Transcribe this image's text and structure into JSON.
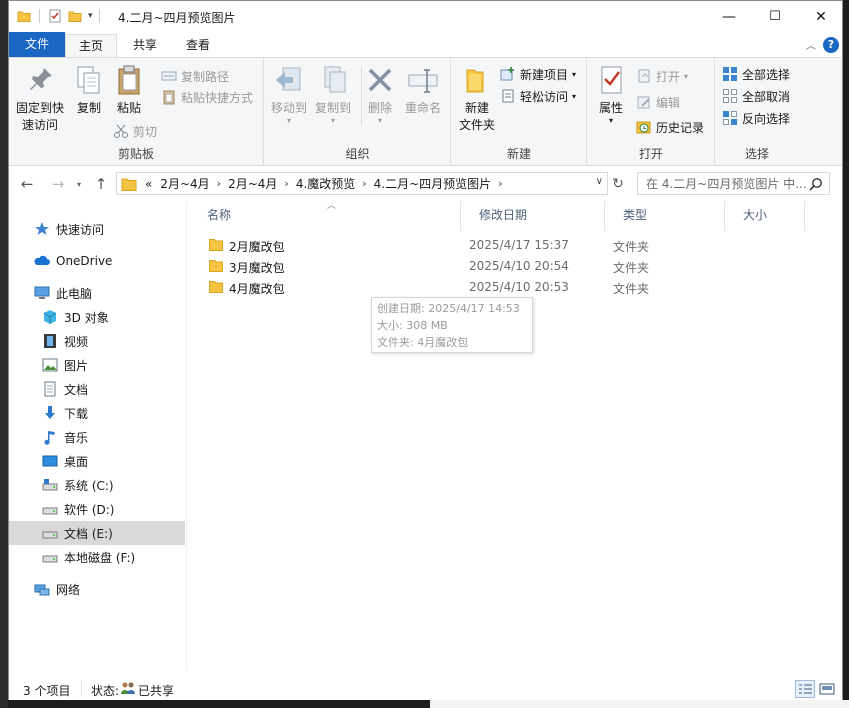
{
  "window": {
    "title": "4.二月~四月预览图片",
    "accent": "#1a66c3",
    "controls": {
      "minimize": "—",
      "maximize": "☐",
      "close": "✕"
    }
  },
  "ribbon_tabs": [
    "文件",
    "主页",
    "共享",
    "查看"
  ],
  "ribbon": {
    "clipboard": {
      "label": "剪贴板",
      "pin": [
        "固定到快",
        "速访问"
      ],
      "copy": "复制",
      "paste": "粘贴",
      "copy_path": "复制路径",
      "paste_shortcut": "粘贴快捷方式",
      "cut": "剪切"
    },
    "organize": {
      "label": "组织",
      "move_to": "移动到",
      "copy_to": "复制到",
      "delete": "删除",
      "rename": "重命名"
    },
    "new": {
      "label": "新建",
      "new_folder": [
        "新建",
        "文件夹"
      ],
      "new_item": "新建项目",
      "easy_access": "轻松访问"
    },
    "open": {
      "label": "打开",
      "properties": "属性",
      "open": "打开",
      "edit": "编辑",
      "history": "历史记录"
    },
    "select": {
      "label": "选择",
      "select_all": "全部选择",
      "select_none": "全部取消",
      "invert": "反向选择"
    }
  },
  "address": {
    "overflow": "«",
    "crumbs": [
      "2月~4月",
      "2月~4月",
      "4.魔改预览",
      "4.二月~四月预览图片"
    ],
    "search_placeholder": "在 4.二月~四月预览图片 中..."
  },
  "nav_pane": {
    "items": [
      {
        "label": "快速访问",
        "icon": "star-icon"
      },
      {
        "label": "OneDrive",
        "icon": "cloud-icon"
      },
      {
        "label": "此电脑",
        "icon": "computer-icon"
      },
      {
        "label": "3D 对象",
        "icon": "cube-icon"
      },
      {
        "label": "视频",
        "icon": "video-icon"
      },
      {
        "label": "图片",
        "icon": "picture-icon"
      },
      {
        "label": "文档",
        "icon": "document-icon"
      },
      {
        "label": "下载",
        "icon": "download-icon"
      },
      {
        "label": "音乐",
        "icon": "music-icon"
      },
      {
        "label": "桌面",
        "icon": "desktop-icon"
      },
      {
        "label": "系统 (C:)",
        "icon": "drive-icon"
      },
      {
        "label": "软件 (D:)",
        "icon": "drive-icon"
      },
      {
        "label": "文档 (E:)",
        "icon": "drive-icon"
      },
      {
        "label": "本地磁盘 (F:)",
        "icon": "drive-icon"
      },
      {
        "label": "网络",
        "icon": "network-icon"
      }
    ],
    "selected": "文档 (E:)"
  },
  "file_list": {
    "columns": [
      "名称",
      "修改日期",
      "类型",
      "大小"
    ],
    "rows": [
      {
        "name": "2月魔改包",
        "modified": "2025/4/17 15:37",
        "type": "文件夹",
        "size": ""
      },
      {
        "name": "3月魔改包",
        "modified": "2025/4/10 20:54",
        "type": "文件夹",
        "size": ""
      },
      {
        "name": "4月魔改包",
        "modified": "2025/4/10 20:53",
        "type": "文件夹",
        "size": ""
      }
    ],
    "tooltip": [
      "创建日期: 2025/4/17 14:53",
      "大小: 308 MB",
      "文件夹: 4月魔改包"
    ]
  },
  "status": {
    "count": "3 个项目",
    "state_label": "状态:",
    "state_value": "已共享"
  }
}
